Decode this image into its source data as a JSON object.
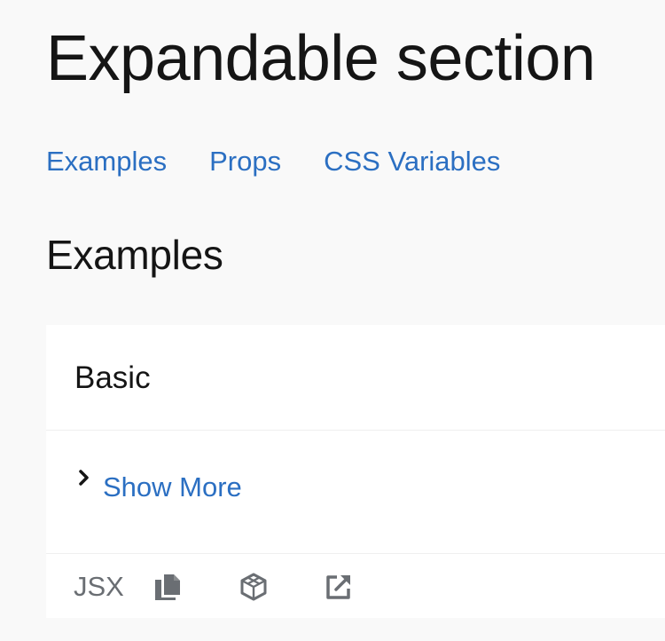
{
  "page": {
    "title": "Expandable section"
  },
  "jump_links": [
    {
      "label": "Examples"
    },
    {
      "label": "Props"
    },
    {
      "label": "CSS Variables"
    }
  ],
  "section": {
    "title": "Examples"
  },
  "example": {
    "title": "Basic",
    "toggle": {
      "label": "Show More",
      "icon": "chevron-right-icon"
    },
    "toolbar": {
      "jsx_label": "JSX",
      "icons": [
        "copy-icon",
        "codesandbox-icon",
        "external-link-icon"
      ]
    }
  },
  "colors": {
    "background": "#f9f9f9",
    "link": "#2b6fc2",
    "text": "#151515",
    "muted": "#6a6e73"
  }
}
